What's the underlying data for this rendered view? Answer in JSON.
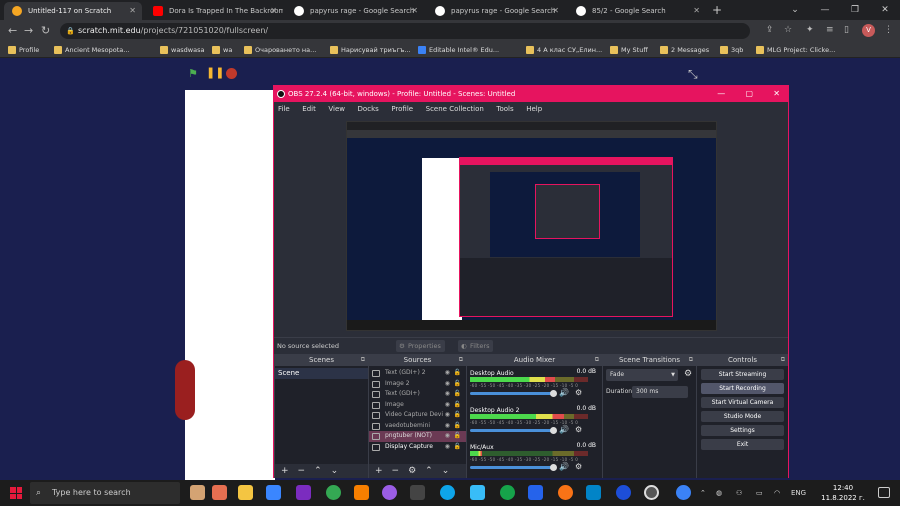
{
  "browser": {
    "tabs": [
      {
        "title": "Untitled-117 on Scratch",
        "active": true,
        "icon": "scratch-icon",
        "color": "#f5a623"
      },
      {
        "title": "Dora Is Trapped In The Backroom",
        "active": false,
        "icon": "youtube-icon",
        "color": "#ff0000"
      },
      {
        "title": "papyrus rage - Google Search",
        "active": false,
        "icon": "google-icon",
        "color": "#ffffff"
      },
      {
        "title": "papyrus rage - Google Search",
        "active": false,
        "icon": "google-icon",
        "color": "#ffffff"
      },
      {
        "title": "85/2 - Google Search",
        "active": false,
        "icon": "google-icon",
        "color": "#ffffff"
      }
    ],
    "url_host": "scratch.mit.edu",
    "url_path": "/projects/721051020/fullscreen/",
    "new_tab": "+",
    "avatar_letter": "V",
    "bookmarks": [
      "Profile",
      "Ancient Mesopota...",
      "wasdwasa",
      "wa",
      "Очароването на...",
      "Нарисувай триъгъ...",
      "Editable Intel® Edu...",
      "4 А клас СУ„Елин...",
      "My Stuff",
      "2 Messages",
      "3qb",
      "MLG Project: Clicke..."
    ]
  },
  "scratch": {
    "controls": {
      "flag": "green-flag-icon",
      "pause": "pause-icon",
      "stop": "stop-icon"
    }
  },
  "obs": {
    "title": "OBS 27.2.4 (64-bit, windows) - Profile: Untitled - Scenes: Untitled",
    "accent": "#e6145f",
    "menu": [
      "File",
      "Edit",
      "View",
      "Docks",
      "Profile",
      "Scene Collection",
      "Tools",
      "Help"
    ],
    "no_source": "No source selected",
    "properties": "Properties",
    "filters": "Filters",
    "docks": {
      "scenes": {
        "title": "Scenes",
        "items": [
          "Scene"
        ]
      },
      "sources": {
        "title": "Sources",
        "items": [
          {
            "name": "Text (GDI+) 2",
            "selected": false,
            "bright": false
          },
          {
            "name": "Image 2",
            "selected": false,
            "bright": false
          },
          {
            "name": "Text (GDI+)",
            "selected": false,
            "bright": false
          },
          {
            "name": "Image",
            "selected": false,
            "bright": false
          },
          {
            "name": "Video Capture Devi",
            "selected": false,
            "bright": false
          },
          {
            "name": "vaedotubemini",
            "selected": false,
            "bright": false
          },
          {
            "name": "pngtuber (NOT)",
            "selected": true,
            "bright": false
          },
          {
            "name": "Display Capture",
            "selected": false,
            "bright": true
          }
        ]
      },
      "mixer": {
        "title": "Audio Mixer",
        "ticks": "-60 -55 -50 -45 -40 -35 -30 -25 -20 -15 -10 -5 0",
        "channels": [
          {
            "name": "Desktop Audio",
            "db": "0.0 dB",
            "level": 0.72
          },
          {
            "name": "Desktop Audio 2",
            "db": "0.0 dB",
            "level": 0.8
          },
          {
            "name": "Mic/Aux",
            "db": "0.0 dB",
            "level": 0.1
          }
        ]
      },
      "transitions": {
        "title": "Scene Transitions",
        "type": "Fade",
        "duration_label": "Duration",
        "duration": "300 ms"
      },
      "controls": {
        "title": "Controls",
        "buttons": [
          "Start Streaming",
          "Start Recording",
          "Start Virtual Camera",
          "Studio Mode",
          "Settings",
          "Exit"
        ]
      }
    }
  },
  "taskbar": {
    "search_placeholder": "Type here to search",
    "language": "ENG",
    "time": "12:40",
    "date": "11.8.2022 г."
  }
}
